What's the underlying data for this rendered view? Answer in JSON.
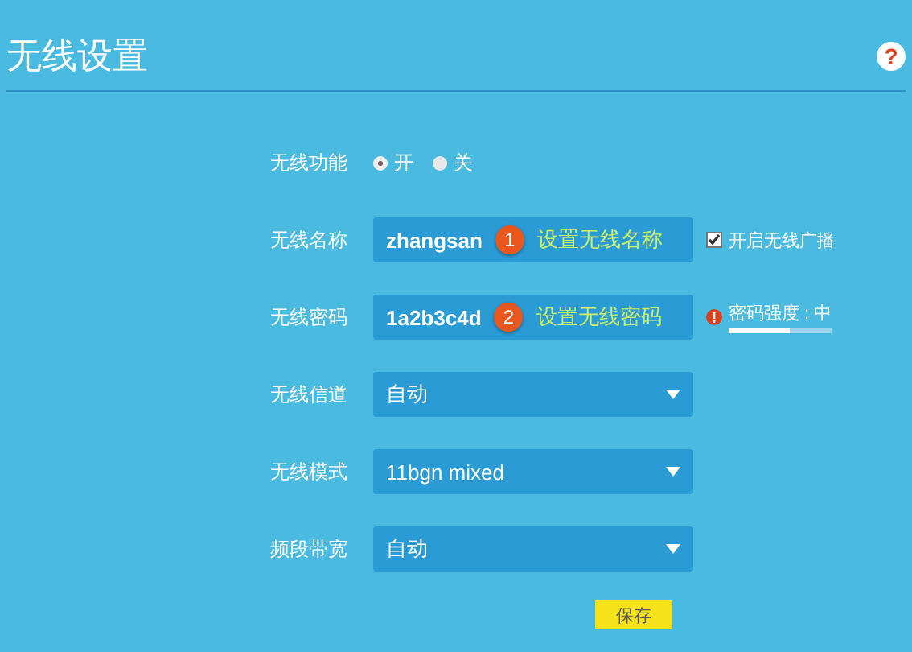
{
  "title": "无线设置",
  "help": "?",
  "rows": [
    {
      "kind": "radio",
      "label": "无线功能",
      "options": [
        {
          "label": "开",
          "selected": true
        },
        {
          "label": "关",
          "selected": false
        }
      ]
    },
    {
      "kind": "text",
      "label": "无线名称",
      "value": "zhangsan",
      "note": {
        "number": "1",
        "text": "设置无线名称"
      },
      "extra": {
        "kind": "checkbox",
        "label": "开启无线广播",
        "checked": true
      }
    },
    {
      "kind": "text",
      "label": "无线密码",
      "value": "1a2b3c4d",
      "note": {
        "number": "2",
        "text": "设置无线密码"
      },
      "extra": {
        "kind": "strength",
        "label": "密码强度 : 中",
        "level": 0.6
      }
    },
    {
      "kind": "select",
      "label": "无线信道",
      "value": "自动"
    },
    {
      "kind": "select",
      "label": "无线模式",
      "value": "11bgn mixed"
    },
    {
      "kind": "select",
      "label": "频段带宽",
      "value": "自动"
    }
  ],
  "save": "保存"
}
